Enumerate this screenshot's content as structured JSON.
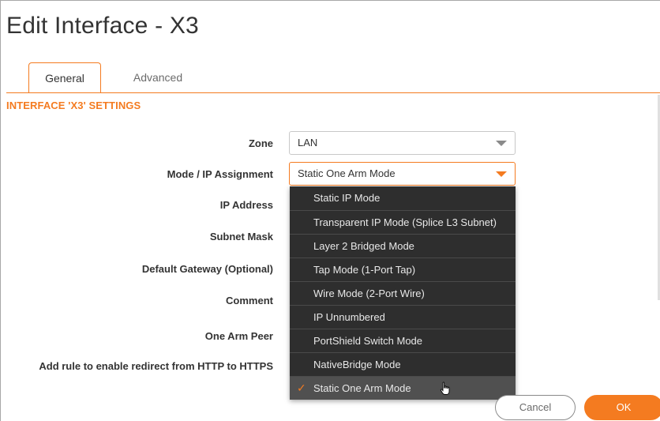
{
  "dialog": {
    "title": "Edit Interface - X3"
  },
  "tabs": [
    {
      "label": "General",
      "active": true
    },
    {
      "label": "Advanced",
      "active": false
    }
  ],
  "section": {
    "title": "INTERFACE 'X3' SETTINGS"
  },
  "fields": {
    "zone": {
      "label": "Zone",
      "value": "LAN"
    },
    "mode": {
      "label": "Mode / IP Assignment",
      "value": "Static One Arm Mode"
    },
    "ip_address": {
      "label": "IP Address"
    },
    "subnet_mask": {
      "label": "Subnet Mask"
    },
    "default_gateway": {
      "label": "Default Gateway (Optional)"
    },
    "comment": {
      "label": "Comment"
    },
    "one_arm_peer": {
      "label": "One Arm Peer"
    },
    "redirect": {
      "label": "Add rule to enable redirect from HTTP to HTTPS"
    }
  },
  "mode_options": [
    "Static IP Mode",
    "Transparent IP Mode (Splice L3 Subnet)",
    "Layer 2 Bridged Mode",
    "Tap Mode (1-Port Tap)",
    "Wire Mode (2-Port Wire)",
    "IP Unnumbered",
    "PortShield Switch Mode",
    "NativeBridge Mode",
    "Static One Arm Mode"
  ],
  "selected_check": "✓",
  "buttons": {
    "cancel": "Cancel",
    "ok": "OK"
  },
  "colors": {
    "accent": "#f47b20",
    "dropdown_bg": "#2e2e2e",
    "dropdown_selected": "#505050"
  },
  "icons": {
    "check": "check-icon",
    "caret": "chevron-down-icon",
    "cursor": "hand-pointer-icon"
  }
}
